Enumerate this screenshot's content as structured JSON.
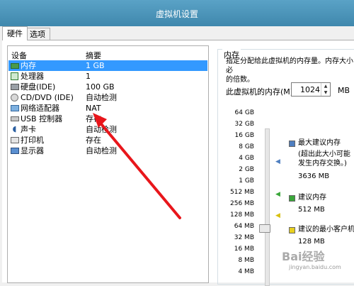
{
  "window": {
    "title": "虚拟机设置"
  },
  "tabs": [
    {
      "label": "硬件"
    },
    {
      "label": "选项"
    }
  ],
  "device_list": {
    "headers": {
      "device": "设备",
      "summary": "摘要"
    },
    "rows": [
      {
        "icon": "memory-icon",
        "name": "内存",
        "value": "1 GB",
        "selected": true
      },
      {
        "icon": "processor-icon",
        "name": "处理器",
        "value": "1"
      },
      {
        "icon": "harddisk-icon",
        "name": "硬盘(IDE)",
        "value": "100 GB"
      },
      {
        "icon": "cd-dvd-icon",
        "name": "CD/DVD (IDE)",
        "value": "自动检测"
      },
      {
        "icon": "network-adapter-icon",
        "name": "网络适配器",
        "value": "NAT"
      },
      {
        "icon": "usb-icon",
        "name": "USB 控制器",
        "value": "存在"
      },
      {
        "icon": "sound-card-icon",
        "name": "声卡",
        "value": "自动检测"
      },
      {
        "icon": "printer-icon",
        "name": "打印机",
        "value": "存在"
      },
      {
        "icon": "display-icon",
        "name": "显示器",
        "value": "自动检测"
      }
    ]
  },
  "memory_panel": {
    "group_title": "内存",
    "description": "指定分配给此虚拟机的内存量。内存大小必\n的倍数。",
    "memory_label": "此虚拟机的内存(M):",
    "memory_value": "1024",
    "unit": "MB",
    "scale_ticks": [
      "64 GB",
      "32 GB",
      "16 GB",
      "8 GB",
      "4 GB",
      "2 GB",
      "1 GB",
      "512 MB",
      "256 MB",
      "128 MB",
      "64 MB",
      "32 MB",
      "16 MB",
      "8 MB",
      "4 MB"
    ],
    "legend": {
      "max_recommended": {
        "title": "最大建议内存",
        "note": "(超出此大小可能\n发生内存交换。)",
        "value": "3636 MB",
        "color": "#4f7fc0"
      },
      "recommended": {
        "title": "建议内存",
        "value": "512 MB",
        "color": "#3aa63a"
      },
      "min_guest": {
        "title": "建议的最小客户机",
        "value": "128 MB",
        "color": "#e8d020"
      }
    }
  },
  "annotation": {
    "arrow_color": "#e8161b"
  },
  "watermark": {
    "text": "Bai经验",
    "sub": "jingyan.baidu.com"
  }
}
